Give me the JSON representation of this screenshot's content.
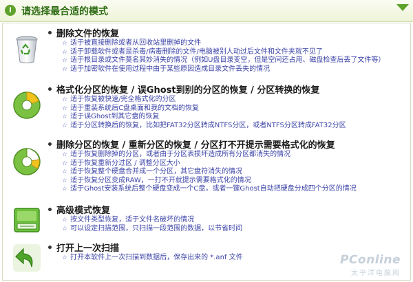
{
  "header": {
    "title": "请选择最合适的模式"
  },
  "sections": [
    {
      "icon": "recycle-bin-icon",
      "title": "删除文件的恢复",
      "items": [
        "适于被直接删除或者从回收站里删掉的文件",
        "适于卸载软件或者是杀毒/病毒删除的文件/电脑被别人动过后文件和文件夹就不见了",
        "适于根目录或文件莫名其妙消失的情况（例如U盘目录变空，但是空间还占用、磁盘检查后丢了文件等）",
        "适于加密软件在使用过程中由于某些原因造成目录文件丢失的情况"
      ]
    },
    {
      "icon": "partition-format-icon",
      "title": "格式化分区的恢复 / 误Ghost到别的分区的恢复 / 分区转换的恢复",
      "items": [
        "适于恢复被快速/完全格式化的分区",
        "适于重装系统后C盘桌面和我的文档的恢复",
        "适于误Ghost到其它盘的恢复",
        "适于分区转换后的恢复，比如把FAT32分区转成NTFS分区，或者NTFS分区转成FAT32分区"
      ]
    },
    {
      "icon": "partition-recover-icon",
      "title": "删除分区的恢复 / 重新分区的恢复 / 分区打不开提示需要格式化的恢复",
      "items": [
        "适于恢复删除掉的分区，或者由于分区表损坏造成所有分区都消失的情况",
        "适于恢复重新分过区 / 调整分区大小",
        "适于恢复整个硬盘合并成一个分区，其它盘符消失的情况",
        "适于恢复分区变成RAW，一打不开就提示需要格式化的情况",
        "适于Ghost安装系统后整个硬盘变成一个C盘，或者一键Ghost自动把硬盘分成四个分区的情况"
      ]
    },
    {
      "icon": "hard-drive-icon",
      "title": "高级模式恢复",
      "items": [
        "按文件类型恢复，适于文件名破坏的情况",
        "可以设定扫描范围，只扫描一段范围的数据，以节省时间"
      ]
    },
    {
      "icon": "back-arrow-icon",
      "title": "打开上一次扫描",
      "items": [
        "打开本软件上一次扫描到数据后，保存出来的 *.anf 文件"
      ]
    }
  ],
  "watermark": {
    "brand": "PConline",
    "subtitle": "太平洋电脑网"
  }
}
